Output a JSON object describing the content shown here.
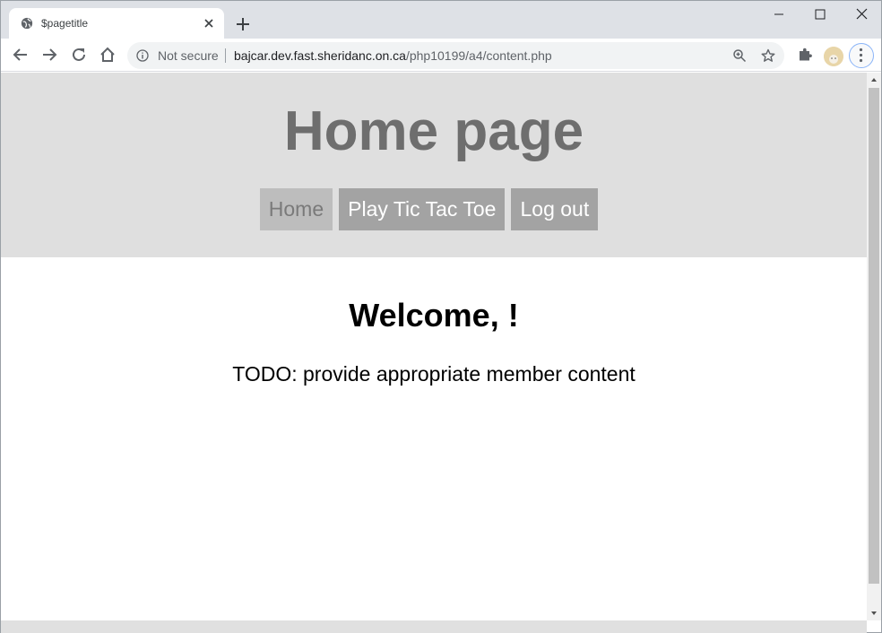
{
  "browser": {
    "tab_title": "$pagetitle",
    "security_label": "Not secure",
    "url_host": "bajcar.dev.fast.sheridanc.on.ca",
    "url_path": "/php10199/a4/content.php",
    "icons": [
      "globe-icon",
      "close-icon",
      "plus-icon",
      "minimize-icon",
      "maximize-icon",
      "close-window-icon",
      "back-arrow-icon",
      "forward-arrow-icon",
      "reload-icon",
      "home-icon",
      "info-icon",
      "zoom-icon",
      "star-icon",
      "puzzle-icon",
      "avatar",
      "kebab-menu-icon"
    ]
  },
  "page": {
    "title": "Home page",
    "nav": [
      {
        "label": "Home",
        "active": true
      },
      {
        "label": "Play Tic Tac Toe",
        "active": false
      },
      {
        "label": "Log out",
        "active": false
      }
    ],
    "welcome": "Welcome, !",
    "content": "TODO: provide appropriate member content"
  },
  "colors": {
    "header_bg": "#dfdfdf",
    "title_color": "#6e6e6e",
    "nav_bg": "#a3a3a3",
    "nav_active_bg": "#bdbdbd",
    "nav_text": "#ffffff",
    "nav_active_text": "#7a7a7a"
  }
}
